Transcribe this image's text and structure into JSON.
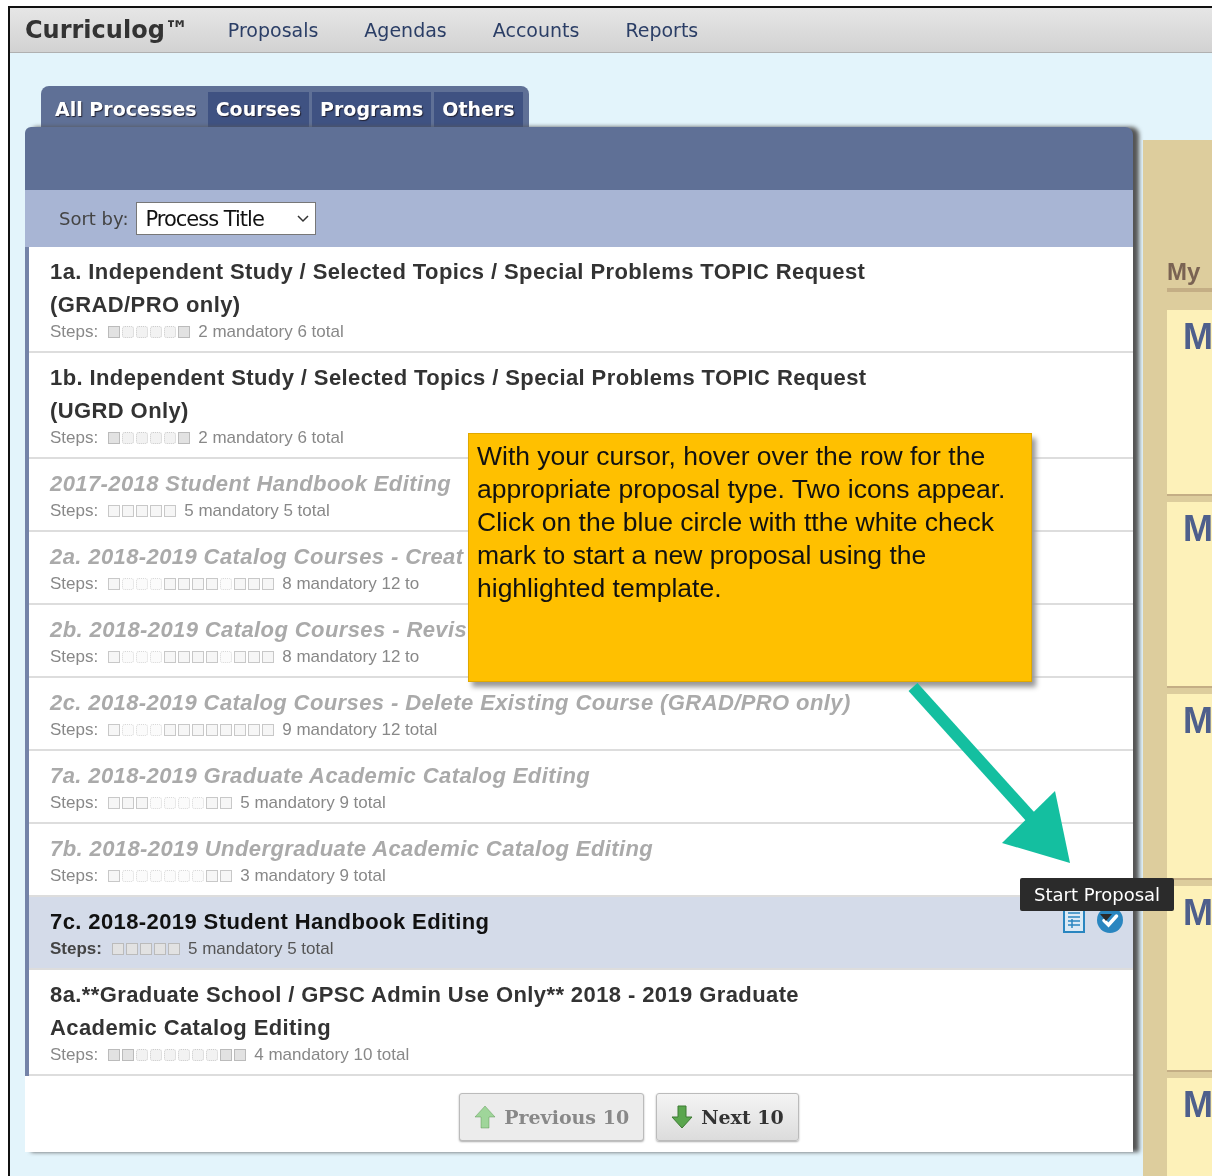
{
  "header": {
    "logo": "Curriculog™",
    "nav": [
      "Proposals",
      "Agendas",
      "Accounts",
      "Reports"
    ]
  },
  "tabs": [
    {
      "label": "All Processes",
      "selected": true
    },
    {
      "label": "Courses",
      "selected": false
    },
    {
      "label": "Programs",
      "selected": false
    },
    {
      "label": "Others",
      "selected": false
    }
  ],
  "sort": {
    "label": "Sort by:",
    "value": "Process Title"
  },
  "processes": [
    {
      "title": "1a. Independent Study / Selected Topics / Special Problems TOPIC Request (GRAD/PRO only)",
      "disabled": false,
      "highlighted": false,
      "steps_label": "Steps:",
      "steps": [
        {
          "mandatory": true
        },
        {
          "mandatory": false
        },
        {
          "mandatory": false
        },
        {
          "mandatory": false
        },
        {
          "mandatory": false
        },
        {
          "mandatory": true
        }
      ],
      "summary": "2 mandatory 6 total"
    },
    {
      "title": "1b. Independent Study / Selected Topics / Special Problems TOPIC Request (UGRD Only)",
      "disabled": false,
      "highlighted": false,
      "steps_label": "Steps:",
      "steps": [
        {
          "mandatory": true
        },
        {
          "mandatory": false
        },
        {
          "mandatory": false
        },
        {
          "mandatory": false
        },
        {
          "mandatory": false
        },
        {
          "mandatory": true
        }
      ],
      "summary": "2 mandatory 6 total"
    },
    {
      "title": "2017-2018 Student Handbook Editing",
      "disabled": true,
      "highlighted": false,
      "steps_label": "Steps:",
      "steps": [
        {
          "mandatory": true
        },
        {
          "mandatory": true
        },
        {
          "mandatory": true
        },
        {
          "mandatory": true
        },
        {
          "mandatory": true
        }
      ],
      "summary": "5 mandatory 5 total"
    },
    {
      "title": "2a. 2018-2019 Catalog Courses - Creat",
      "disabled": true,
      "highlighted": false,
      "steps_label": "Steps:",
      "steps": [
        {
          "mandatory": true
        },
        {
          "mandatory": false
        },
        {
          "mandatory": false
        },
        {
          "mandatory": false
        },
        {
          "mandatory": true
        },
        {
          "mandatory": true
        },
        {
          "mandatory": true
        },
        {
          "mandatory": true
        },
        {
          "mandatory": false
        },
        {
          "mandatory": true
        },
        {
          "mandatory": true
        },
        {
          "mandatory": true
        }
      ],
      "summary": "8 mandatory 12 to"
    },
    {
      "title": "2b. 2018-2019 Catalog Courses - Revis",
      "disabled": true,
      "highlighted": false,
      "steps_label": "Steps:",
      "steps": [
        {
          "mandatory": true
        },
        {
          "mandatory": false
        },
        {
          "mandatory": false
        },
        {
          "mandatory": false
        },
        {
          "mandatory": true
        },
        {
          "mandatory": true
        },
        {
          "mandatory": true
        },
        {
          "mandatory": true
        },
        {
          "mandatory": false
        },
        {
          "mandatory": true
        },
        {
          "mandatory": true
        },
        {
          "mandatory": true
        }
      ],
      "summary": "8 mandatory 12 to"
    },
    {
      "title": "2c. 2018-2019 Catalog Courses - Delete Existing Course (GRAD/PRO only)",
      "disabled": true,
      "highlighted": false,
      "steps_label": "Steps:",
      "steps": [
        {
          "mandatory": true
        },
        {
          "mandatory": false
        },
        {
          "mandatory": false
        },
        {
          "mandatory": false
        },
        {
          "mandatory": true
        },
        {
          "mandatory": true
        },
        {
          "mandatory": true
        },
        {
          "mandatory": true
        },
        {
          "mandatory": true
        },
        {
          "mandatory": true
        },
        {
          "mandatory": true
        },
        {
          "mandatory": true
        }
      ],
      "summary": "9 mandatory 12 total"
    },
    {
      "title": "7a. 2018-2019 Graduate Academic Catalog Editing",
      "disabled": true,
      "highlighted": false,
      "steps_label": "Steps:",
      "steps": [
        {
          "mandatory": true
        },
        {
          "mandatory": true
        },
        {
          "mandatory": true
        },
        {
          "mandatory": false
        },
        {
          "mandatory": false
        },
        {
          "mandatory": false
        },
        {
          "mandatory": false
        },
        {
          "mandatory": true
        },
        {
          "mandatory": true
        }
      ],
      "summary": "5 mandatory 9 total"
    },
    {
      "title": "7b. 2018-2019 Undergraduate Academic Catalog Editing",
      "disabled": true,
      "highlighted": false,
      "steps_label": "Steps:",
      "steps": [
        {
          "mandatory": true
        },
        {
          "mandatory": false
        },
        {
          "mandatory": false
        },
        {
          "mandatory": false
        },
        {
          "mandatory": false
        },
        {
          "mandatory": false
        },
        {
          "mandatory": false
        },
        {
          "mandatory": true
        },
        {
          "mandatory": true
        }
      ],
      "summary": "3 mandatory 9 total"
    },
    {
      "title": "7c. 2018-2019 Student Handbook Editing",
      "disabled": false,
      "highlighted": true,
      "steps_label": "Steps:",
      "steps": [
        {
          "mandatory": true
        },
        {
          "mandatory": true
        },
        {
          "mandatory": true
        },
        {
          "mandatory": true
        },
        {
          "mandatory": true
        }
      ],
      "summary": "5 mandatory 5 total"
    },
    {
      "title": "8a.**Graduate School / GPSC Admin Use Only** 2018 - 2019 Graduate Academic Catalog Editing",
      "disabled": false,
      "highlighted": false,
      "steps_label": "Steps:",
      "steps": [
        {
          "mandatory": true
        },
        {
          "mandatory": true
        },
        {
          "mandatory": false
        },
        {
          "mandatory": false
        },
        {
          "mandatory": false
        },
        {
          "mandatory": false
        },
        {
          "mandatory": false
        },
        {
          "mandatory": false
        },
        {
          "mandatory": true
        },
        {
          "mandatory": true
        }
      ],
      "summary": "4 mandatory 10 total"
    }
  ],
  "pagination": [
    {
      "label": "Previous 10",
      "kind": "previous",
      "disabled": true
    },
    {
      "label": "Next 10",
      "kind": "next",
      "disabled": false
    }
  ],
  "tooltip": {
    "text": "Start Proposal"
  },
  "callout": {
    "paragraphs": [
      "With your cursor, hover over the row for the appropriate proposal type. Two icons appear.",
      "Click on the blue circle with tthe white check mark to start a new proposal using the highlighted template."
    ]
  },
  "side_panel": {
    "heading": "My",
    "cards": [
      {
        "title": "M"
      },
      {
        "title": "M"
      },
      {
        "title": "M"
      },
      {
        "title": "M"
      },
      {
        "title": "M"
      }
    ]
  }
}
